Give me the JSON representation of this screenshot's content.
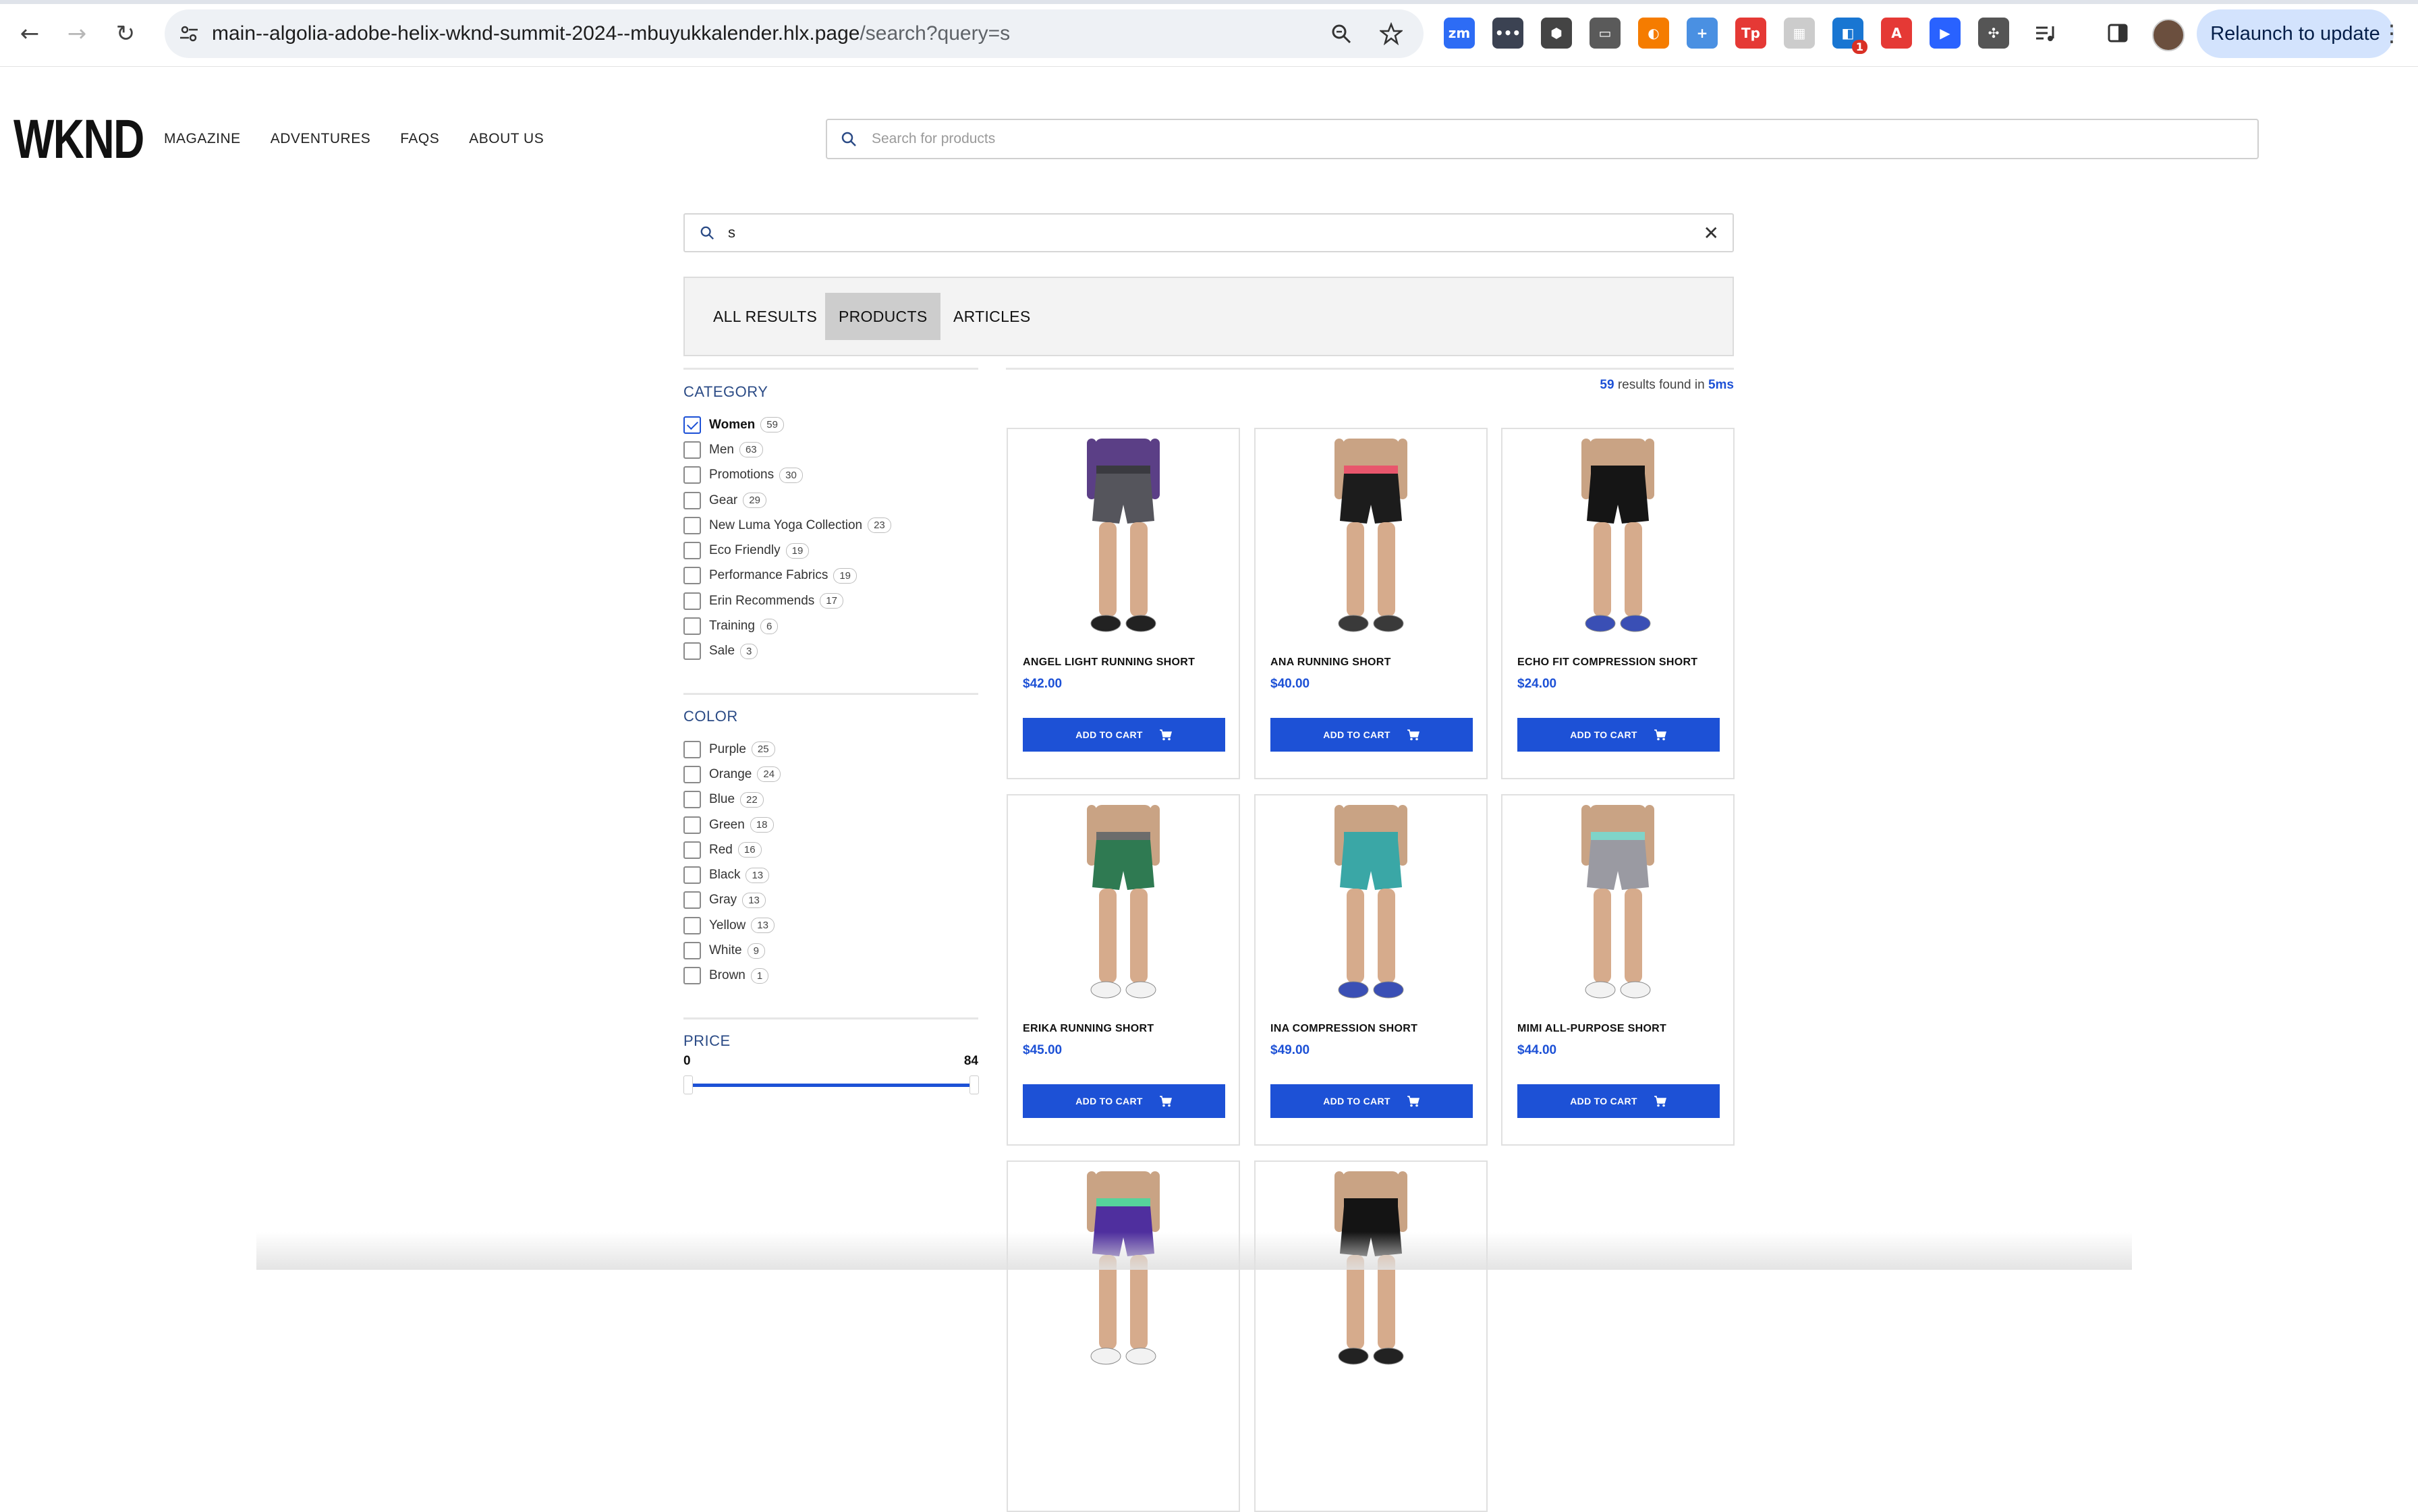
{
  "browser": {
    "url_main": "main--algolia-adobe-helix-wknd-summit-2024--mbuyukkalender.hlx.page",
    "url_rest": "/search?query=s",
    "relaunch_label": "Relaunch to update",
    "extensions": [
      {
        "name": "zoom-extension-icon",
        "text": "zm",
        "color": "#2d6cf5"
      },
      {
        "name": "dots-extension-icon",
        "text": "•••",
        "color": "#3b4252"
      },
      {
        "name": "hex-extension-icon",
        "text": "⬢",
        "color": "#444444"
      },
      {
        "name": "pill-extension-icon",
        "text": "▭",
        "color": "#5a5a5a"
      },
      {
        "name": "circle-extension-icon",
        "text": "◐",
        "color": "#f57c00"
      },
      {
        "name": "plus-extension-icon",
        "text": "+",
        "color": "#4a90e2"
      },
      {
        "name": "tp-extension-icon",
        "text": "Tp",
        "color": "#e53935"
      },
      {
        "name": "grid-extension-icon",
        "text": "▦",
        "color": "#cccccc"
      },
      {
        "name": "badge-extension-icon",
        "text": "◧",
        "color": "#1976d2",
        "badge": "1"
      },
      {
        "name": "acrobat-extension-icon",
        "text": "A",
        "color": "#e53935"
      },
      {
        "name": "chat-extension-icon",
        "text": "▶",
        "color": "#2962ff"
      },
      {
        "name": "puzzle-extension-icon",
        "text": "✣",
        "color": "#555555"
      }
    ]
  },
  "site": {
    "logo": "WKND",
    "nav": [
      "MAGAZINE",
      "ADVENTURES",
      "FAQS",
      "ABOUT US"
    ],
    "header_search_placeholder": "Search for products"
  },
  "search": {
    "query": "s",
    "tabs": [
      {
        "label": "ALL RESULTS",
        "active": false
      },
      {
        "label": "PRODUCTS",
        "active": true
      },
      {
        "label": "ARTICLES",
        "active": false
      }
    ],
    "stats": {
      "count": "59",
      "mid": " results found in ",
      "time": "5ms"
    }
  },
  "facets": {
    "category": {
      "title": "CATEGORY",
      "items": [
        {
          "label": "Women",
          "count": "59",
          "checked": true
        },
        {
          "label": "Men",
          "count": "63",
          "checked": false
        },
        {
          "label": "Promotions",
          "count": "30",
          "checked": false
        },
        {
          "label": "Gear",
          "count": "29",
          "checked": false
        },
        {
          "label": "New Luma Yoga Collection",
          "count": "23",
          "checked": false
        },
        {
          "label": "Eco Friendly",
          "count": "19",
          "checked": false
        },
        {
          "label": "Performance Fabrics",
          "count": "19",
          "checked": false
        },
        {
          "label": "Erin Recommends",
          "count": "17",
          "checked": false
        },
        {
          "label": "Training",
          "count": "6",
          "checked": false
        },
        {
          "label": "Sale",
          "count": "3",
          "checked": false
        }
      ]
    },
    "color": {
      "title": "COLOR",
      "items": [
        {
          "label": "Purple",
          "count": "25",
          "checked": false
        },
        {
          "label": "Orange",
          "count": "24",
          "checked": false
        },
        {
          "label": "Blue",
          "count": "22",
          "checked": false
        },
        {
          "label": "Green",
          "count": "18",
          "checked": false
        },
        {
          "label": "Red",
          "count": "16",
          "checked": false
        },
        {
          "label": "Black",
          "count": "13",
          "checked": false
        },
        {
          "label": "Gray",
          "count": "13",
          "checked": false
        },
        {
          "label": "Yellow",
          "count": "13",
          "checked": false
        },
        {
          "label": "White",
          "count": "9",
          "checked": false
        },
        {
          "label": "Brown",
          "count": "1",
          "checked": false
        }
      ]
    },
    "price": {
      "title": "PRICE",
      "min": "0",
      "max": "84"
    }
  },
  "products": [
    {
      "name": "ANGEL LIGHT RUNNING SHORT",
      "price": "$42.00",
      "short_color": "#55555c",
      "band_color": "#3a3a40",
      "top_color": "#5b3f86",
      "shoe_color": "#222222"
    },
    {
      "name": "ANA RUNNING SHORT",
      "price": "$40.00",
      "short_color": "#1c1c1c",
      "band_color": "#e8566c",
      "top_color": "#c9a384",
      "shoe_color": "#3a3a3a"
    },
    {
      "name": "ECHO FIT COMPRESSION SHORT",
      "price": "$24.00",
      "short_color": "#151515",
      "band_color": "#151515",
      "top_color": "#c9a384",
      "shoe_color": "#3a4fb5"
    },
    {
      "name": "ERIKA RUNNING SHORT",
      "price": "$45.00",
      "short_color": "#2f7a52",
      "band_color": "#6c6c6c",
      "top_color": "#c9a384",
      "shoe_color": "#f2f2f2"
    },
    {
      "name": "INA COMPRESSION SHORT",
      "price": "$49.00",
      "short_color": "#3aa7a6",
      "band_color": "#3aa7a6",
      "top_color": "#c9a384",
      "shoe_color": "#3a4fb5"
    },
    {
      "name": "MIMI ALL-PURPOSE SHORT",
      "price": "$44.00",
      "short_color": "#9a9aa2",
      "band_color": "#7fd4c9",
      "top_color": "#c9a384",
      "shoe_color": "#f2f2f2"
    },
    {
      "name": "",
      "price": "",
      "short_color": "#4f2f9e",
      "band_color": "#56d39b",
      "top_color": "#c9a384",
      "shoe_color": "#f2f2f2"
    },
    {
      "name": "",
      "price": "",
      "short_color": "#141414",
      "band_color": "#141414",
      "top_color": "#c9a384",
      "shoe_color": "#222222"
    }
  ],
  "add_to_cart_label": "ADD TO CART"
}
